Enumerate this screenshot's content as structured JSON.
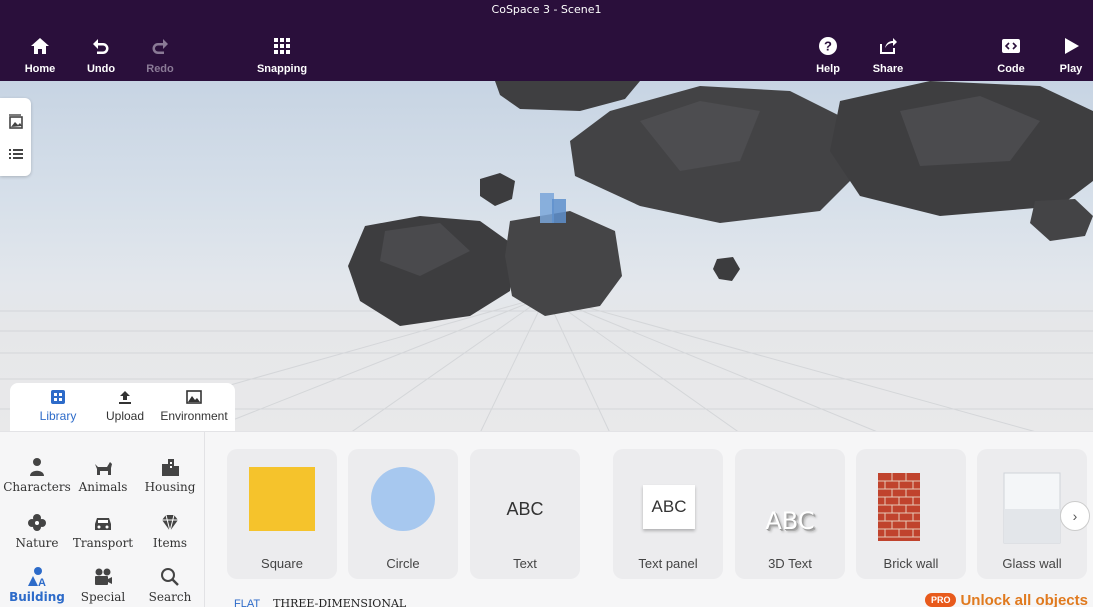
{
  "window": {
    "title": "CoSpace 3 - Scene1"
  },
  "toolbar": {
    "home": "Home",
    "undo": "Undo",
    "redo": "Redo",
    "snapping": "Snapping",
    "help": "Help",
    "share": "Share",
    "code": "Code",
    "play": "Play"
  },
  "sidestrip": {
    "icons": [
      "gallery-icon",
      "list-icon"
    ]
  },
  "panel_tabs": {
    "library": "Library",
    "upload": "Upload",
    "environment": "Environment",
    "active": "Library"
  },
  "categories": {
    "characters": "Characters",
    "animals": "Animals",
    "housing": "Housing",
    "nature": "Nature",
    "transport": "Transport",
    "items": "Items",
    "building": "Building",
    "special": "Special",
    "search": "Search",
    "active": "Building"
  },
  "library_items": {
    "square": "Square",
    "circle": "Circle",
    "text": "Text",
    "text_panel": "Text panel",
    "threed_text": "3D Text",
    "brick_wall": "Brick wall",
    "glass_wall": "Glass wall"
  },
  "thumb_text": {
    "abc": "ABC",
    "abc_panel": "ABC",
    "abc_3d": "ABC"
  },
  "mode": {
    "flat": "FLAT",
    "three_d": "THREE-DIMENSIONAL",
    "active": "FLAT"
  },
  "promo": {
    "badge": "PRO",
    "text": "Unlock all objects"
  },
  "colors": {
    "topbar": "#2a0f3b",
    "accent": "#2d6bc9",
    "square": "#f5c32c",
    "circle": "#a7c8ef",
    "promo": "#e07a1f"
  }
}
